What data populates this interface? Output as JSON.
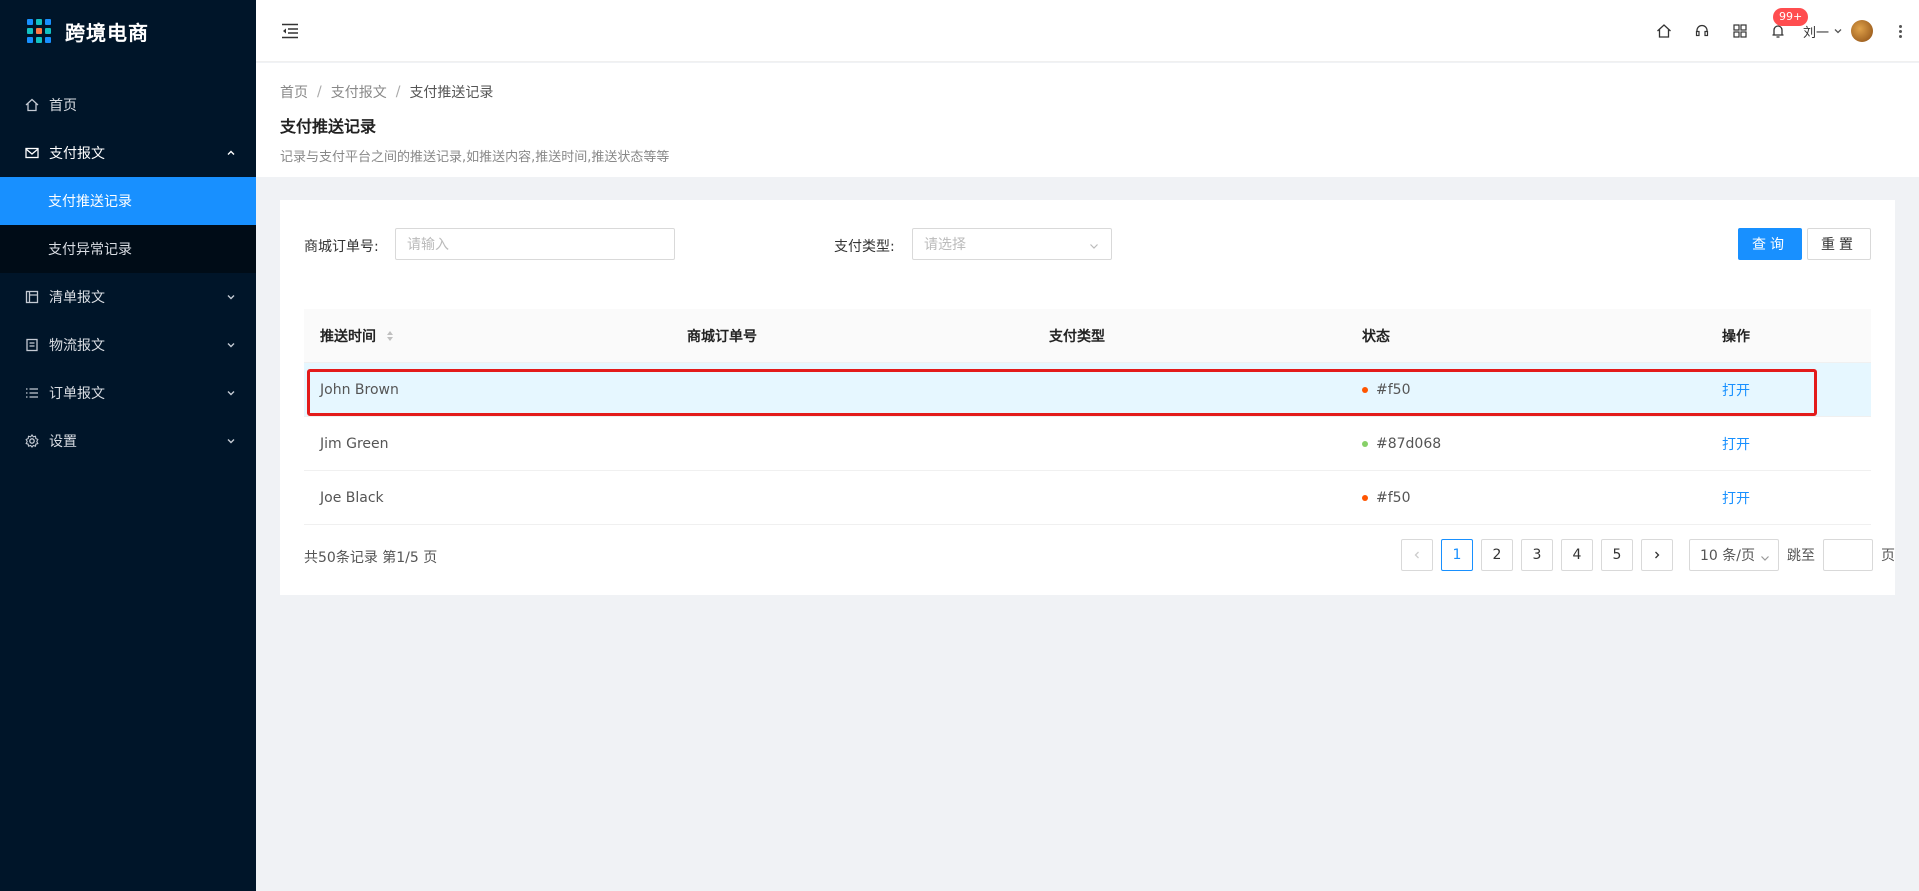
{
  "app": {
    "title": "跨境电商"
  },
  "sidebar": {
    "items": [
      {
        "label": "首页",
        "icon": "home-icon"
      },
      {
        "label": "支付报文",
        "icon": "mail-icon",
        "open": true,
        "children": [
          {
            "label": "支付推送记录",
            "active": true
          },
          {
            "label": "支付异常记录",
            "active": false
          }
        ]
      },
      {
        "label": "清单报文",
        "icon": "profile-icon"
      },
      {
        "label": "物流报文",
        "icon": "container-icon"
      },
      {
        "label": "订单报文",
        "icon": "unordered-list-icon"
      },
      {
        "label": "设置",
        "icon": "setting-icon"
      }
    ]
  },
  "header": {
    "notification_count": "99+",
    "user_name": "刘一"
  },
  "breadcrumb": {
    "items": [
      "首页",
      "支付报文",
      "支付推送记录"
    ]
  },
  "page": {
    "title": "支付推送记录",
    "description": "记录与支付平台之间的推送记录,如推送内容,推送时间,推送状态等等"
  },
  "filters": {
    "order_label": "商城订单号:",
    "order_placeholder": "请输入",
    "paytype_label": "支付类型:",
    "paytype_placeholder": "请选择",
    "query_button": "查询",
    "reset_button": "重置"
  },
  "table": {
    "columns": [
      "推送时间",
      "商城订单号",
      "支付类型",
      "状态",
      "操作"
    ],
    "rows": [
      {
        "time": "John Brown",
        "order": "",
        "paytype": "",
        "status": "#f50",
        "status_color": "#ff5500",
        "action": "打开"
      },
      {
        "time": "Jim Green",
        "order": "",
        "paytype": "",
        "status": "#87d068",
        "status_color": "#87d068",
        "action": "打开"
      },
      {
        "time": "Joe Black",
        "order": "",
        "paytype": "",
        "status": "#f50",
        "status_color": "#ff5500",
        "action": "打开"
      }
    ]
  },
  "pagination": {
    "summary": "共50条记录 第1/5 页",
    "pages": [
      "1",
      "2",
      "3",
      "4",
      "5"
    ],
    "current": "1",
    "page_size": "10 条/页",
    "jump_label": "跳至",
    "jump_suffix": "页"
  },
  "colors": {
    "primary": "#1890ff",
    "sidebar_bg": "#001529",
    "highlight_border": "#e31b1b"
  }
}
